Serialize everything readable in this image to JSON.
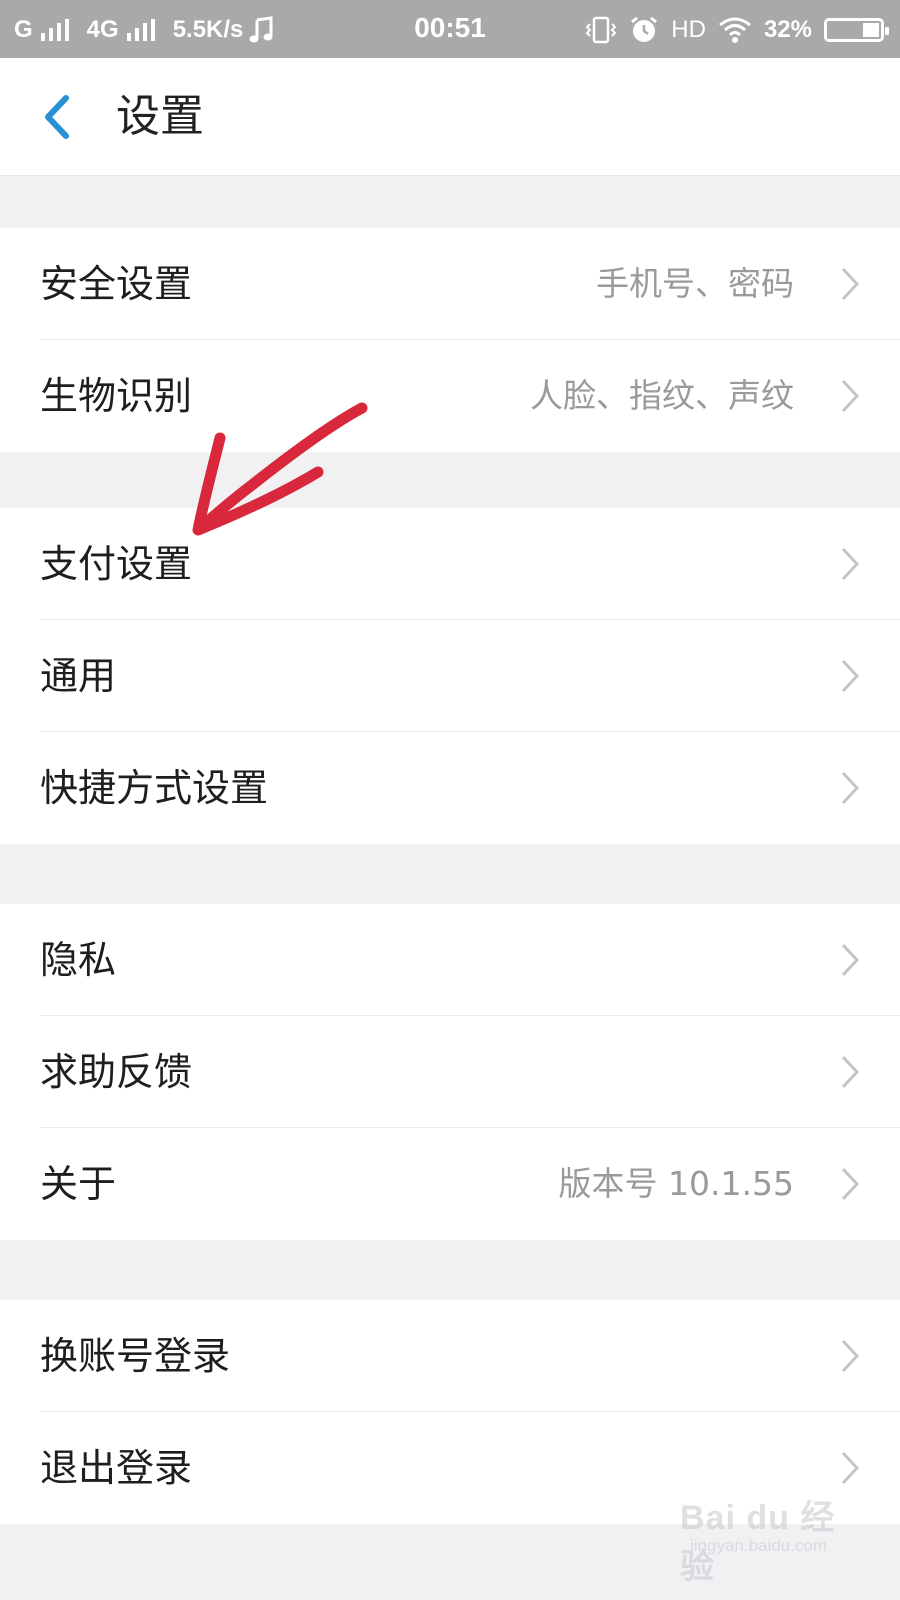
{
  "status_bar": {
    "carrier_1": "G",
    "carrier_2": "4G",
    "speed": "5.5K/s",
    "time": "00:51",
    "hd": "HD",
    "battery": "32%",
    "battery_level": 0.32,
    "icons": [
      "signal-icon",
      "music-icon",
      "vibrate-icon",
      "alarm-icon",
      "wifi-icon",
      "battery-icon"
    ]
  },
  "header": {
    "back_icon": "back-chevron-icon",
    "title": "设置"
  },
  "groups": [
    {
      "items": [
        {
          "label": "安全设置",
          "value": "手机号、密码"
        },
        {
          "label": "生物识别",
          "value": "人脸、指纹、声纹"
        }
      ]
    },
    {
      "items": [
        {
          "label": "支付设置",
          "value": ""
        },
        {
          "label": "通用",
          "value": ""
        },
        {
          "label": "快捷方式设置",
          "value": ""
        }
      ]
    },
    {
      "items": [
        {
          "label": "隐私",
          "value": ""
        },
        {
          "label": "求助反馈",
          "value": ""
        },
        {
          "label": "关于",
          "value": "版本号 10.1.55"
        }
      ]
    },
    {
      "items": [
        {
          "label": "换账号登录",
          "value": ""
        },
        {
          "label": "退出登录",
          "value": ""
        }
      ]
    }
  ],
  "annotation": {
    "type": "hand-drawn-arrow",
    "points_to": "支付设置",
    "color": "#d9283c"
  },
  "watermark": {
    "brand": "Bai du 经验",
    "url": "jingyan.baidu.com"
  },
  "colors": {
    "accent": "#2b8fd6",
    "background": "#f1f0f3",
    "status_bar": "#a9a8ab",
    "value_text": "#9a9a9a"
  }
}
